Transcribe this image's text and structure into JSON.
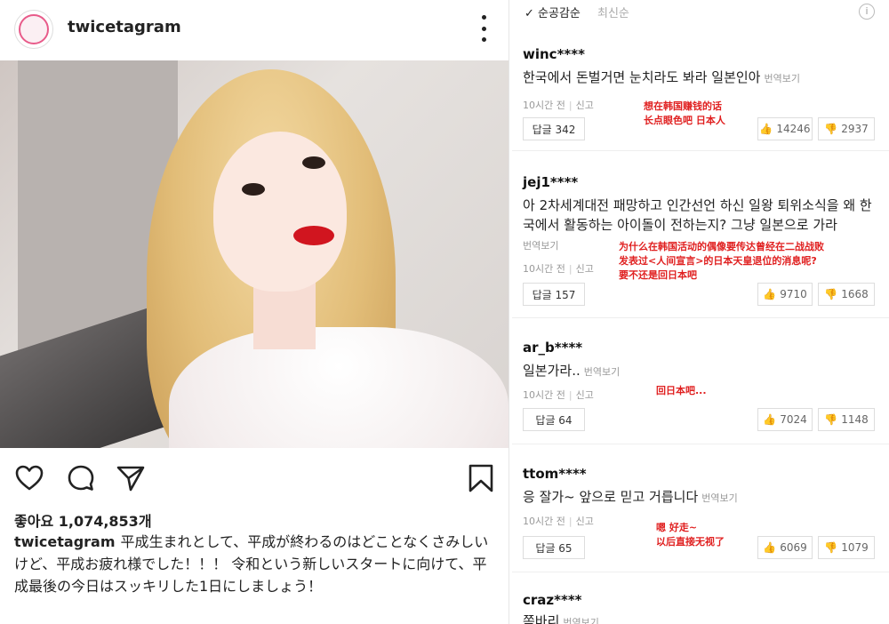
{
  "post": {
    "username": "twicetagram",
    "likes_label": "좋아요 1,074,853개",
    "caption_user": "twicetagram",
    "caption_text": "平成生まれとして、平成が終わるのはどことなくさみしいけど、平成お疲れ様でした！！！ 令和という新しいスタートに向けて、平成最後の今日はスッキリした1日にしましょう！",
    "icons": [
      "heart-icon",
      "comment-icon",
      "share-icon",
      "bookmark-icon",
      "more-icon"
    ]
  },
  "comments_panel": {
    "sort_active": "순공감순",
    "sort_other": "최신순",
    "info_icon": "i",
    "comments": [
      {
        "user": "winc****",
        "text": "한국에서 돈벌거면 눈치라도 봐라 일본인아",
        "translate": "번역보기",
        "time": "10시간 전",
        "report": "신고",
        "reply": "답글 342",
        "likes": "14246",
        "dislikes": "2937",
        "annotation": "想在韩国赚钱的话\n长点眼色吧 日本人"
      },
      {
        "user": "jej1****",
        "text": "아 2차세계대전 패망하고 인간선언 하신 일왕 퇴위소식을 왜 한국에서 활동하는 아이돌이 전하는지? 그냥 일본으로 가라",
        "translate": "번역보기",
        "time": "10시간 전",
        "report": "신고",
        "reply": "답글 157",
        "likes": "9710",
        "dislikes": "1668",
        "annotation": "为什么在韩国活动的偶像要传达曾经在二战战败\n发表过<人间宣言>的日本天皇退位的消息呢?\n要不还是回日本吧"
      },
      {
        "user": "ar_b****",
        "text": "일본가라..",
        "translate": "번역보기",
        "time": "10시간 전",
        "report": "신고",
        "reply": "답글 64",
        "likes": "7024",
        "dislikes": "1148",
        "annotation": "回日本吧..."
      },
      {
        "user": "ttom****",
        "text": "응 잘가~ 앞으로 믿고 거릅니다",
        "translate": "번역보기",
        "time": "10시간 전",
        "report": "신고",
        "reply": "답글 65",
        "likes": "6069",
        "dislikes": "1079",
        "annotation": "嗯 好走~\n以后直接无视了"
      },
      {
        "user": "craz****",
        "text": "쪽바리",
        "translate": "번역보기"
      }
    ]
  },
  "colors": {
    "annotation_red": "#e02020",
    "like_orange": "#e8803a"
  }
}
